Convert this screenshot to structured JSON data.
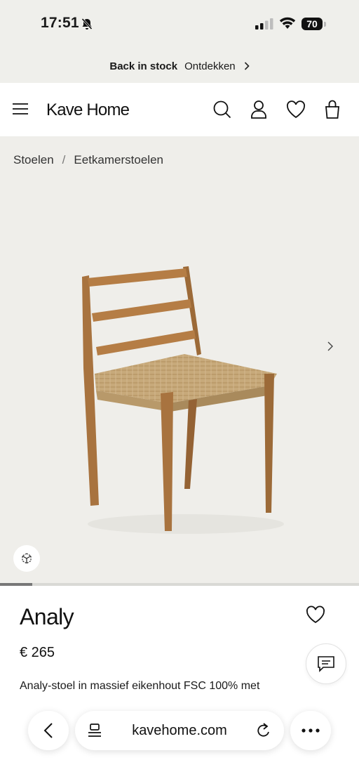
{
  "status_bar": {
    "time": "17:51",
    "battery": "70"
  },
  "promo": {
    "bold": "Back in stock",
    "link": "Ontdekken"
  },
  "header": {
    "logo": "Kave Home"
  },
  "breadcrumb": {
    "items": [
      "Stoelen",
      "Eetkamerstoelen"
    ],
    "separator": "/"
  },
  "product": {
    "title": "Analy",
    "price": "€ 265",
    "description": "Analy-stoel in massief eikenhout FSC 100% met",
    "gallery_progress": 0.09
  },
  "browser": {
    "url": "kavehome.com"
  }
}
